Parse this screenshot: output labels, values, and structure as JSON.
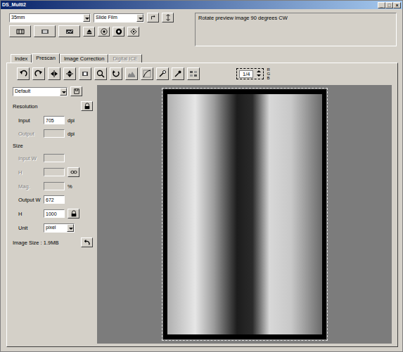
{
  "window": {
    "title": "DS_Multi2",
    "controls": [
      "_",
      "□",
      "×"
    ]
  },
  "film_format": {
    "value": "35mm"
  },
  "film_type": {
    "value": "Slide Film"
  },
  "message": "Rotate preview image 90 degrees CW",
  "tabs": [
    {
      "label": "Index",
      "selected": false,
      "disabled": false
    },
    {
      "label": "Prescan",
      "selected": true,
      "disabled": false
    },
    {
      "label": "Image Correction",
      "selected": false,
      "disabled": false
    },
    {
      "label": "Digital ICE",
      "selected": false,
      "disabled": true
    }
  ],
  "frame": {
    "value": "1/4"
  },
  "channels": [
    "R",
    "G",
    "B"
  ],
  "panel": {
    "preset": "Default",
    "resolution": {
      "heading": "Resolution",
      "input": {
        "label": "Input",
        "value": "705",
        "unit": "dpi",
        "disabled": false
      },
      "output": {
        "label": "Output",
        "unit": "dpi",
        "disabled": true
      }
    },
    "size": {
      "heading": "Size",
      "input_w": {
        "label": "Input W",
        "disabled": true
      },
      "input_h": {
        "label": "H",
        "disabled": true
      },
      "mag": {
        "label": "Mag.",
        "unit": "%",
        "disabled": true
      },
      "output_w": {
        "label": "Output W",
        "value": "672",
        "disabled": false
      },
      "output_h": {
        "label": "H",
        "value": "1000",
        "disabled": false
      },
      "unit": {
        "label": "Unit",
        "value": "pixel"
      }
    },
    "image_size": "Image Size : 1.9MB"
  }
}
